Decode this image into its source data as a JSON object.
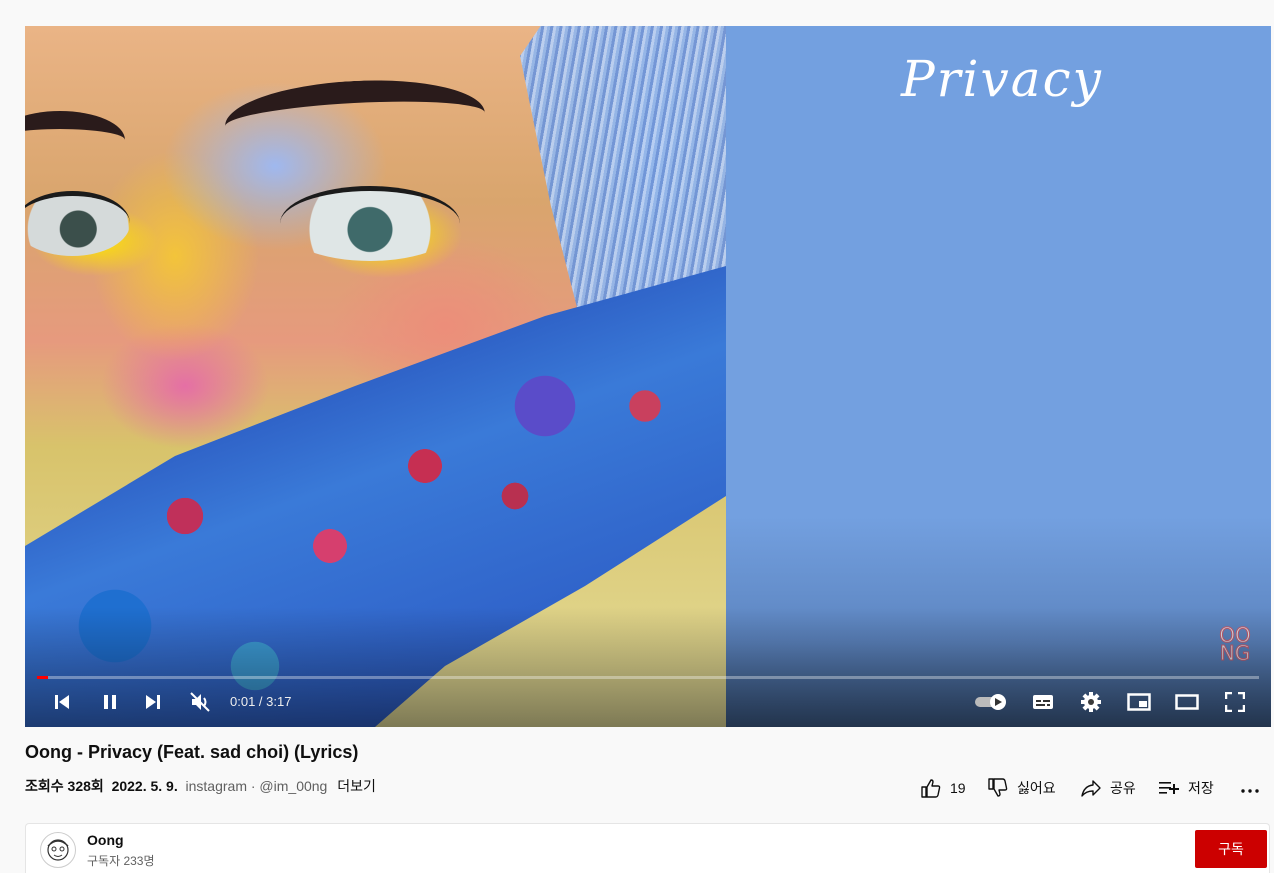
{
  "player": {
    "cover_title": "Privacy",
    "watermark_line1": "OO",
    "watermark_line2": "NG",
    "time_current": "0:01",
    "time_total": "3:17",
    "time_display": "0:01 / 3:17",
    "progress_fraction": 0.005,
    "progress_color": "#ff0000",
    "controls": [
      "previous-icon",
      "pause-icon",
      "next-icon",
      "mute-icon",
      "autoplay-toggle",
      "subtitles-icon",
      "settings-gear-icon",
      "miniplayer-icon",
      "theater-mode-icon",
      "fullscreen-icon"
    ]
  },
  "video": {
    "title": "Oong - Privacy (Feat. sad choi) (Lyrics)",
    "views": "조회수 328회",
    "date": "2022. 5. 9.",
    "description_preview": "instagram · @im_00ng",
    "more_label": "더보기"
  },
  "actions": {
    "like_count": "19",
    "dislike_label": "싫어요",
    "share_label": "공유",
    "save_label": "저장",
    "more_icon": "more-horizontal-icon"
  },
  "channel": {
    "name": "Oong",
    "subscribers": "구독자 233명",
    "subscribe_label": "구독",
    "subscribe_color": "#cc0000"
  }
}
